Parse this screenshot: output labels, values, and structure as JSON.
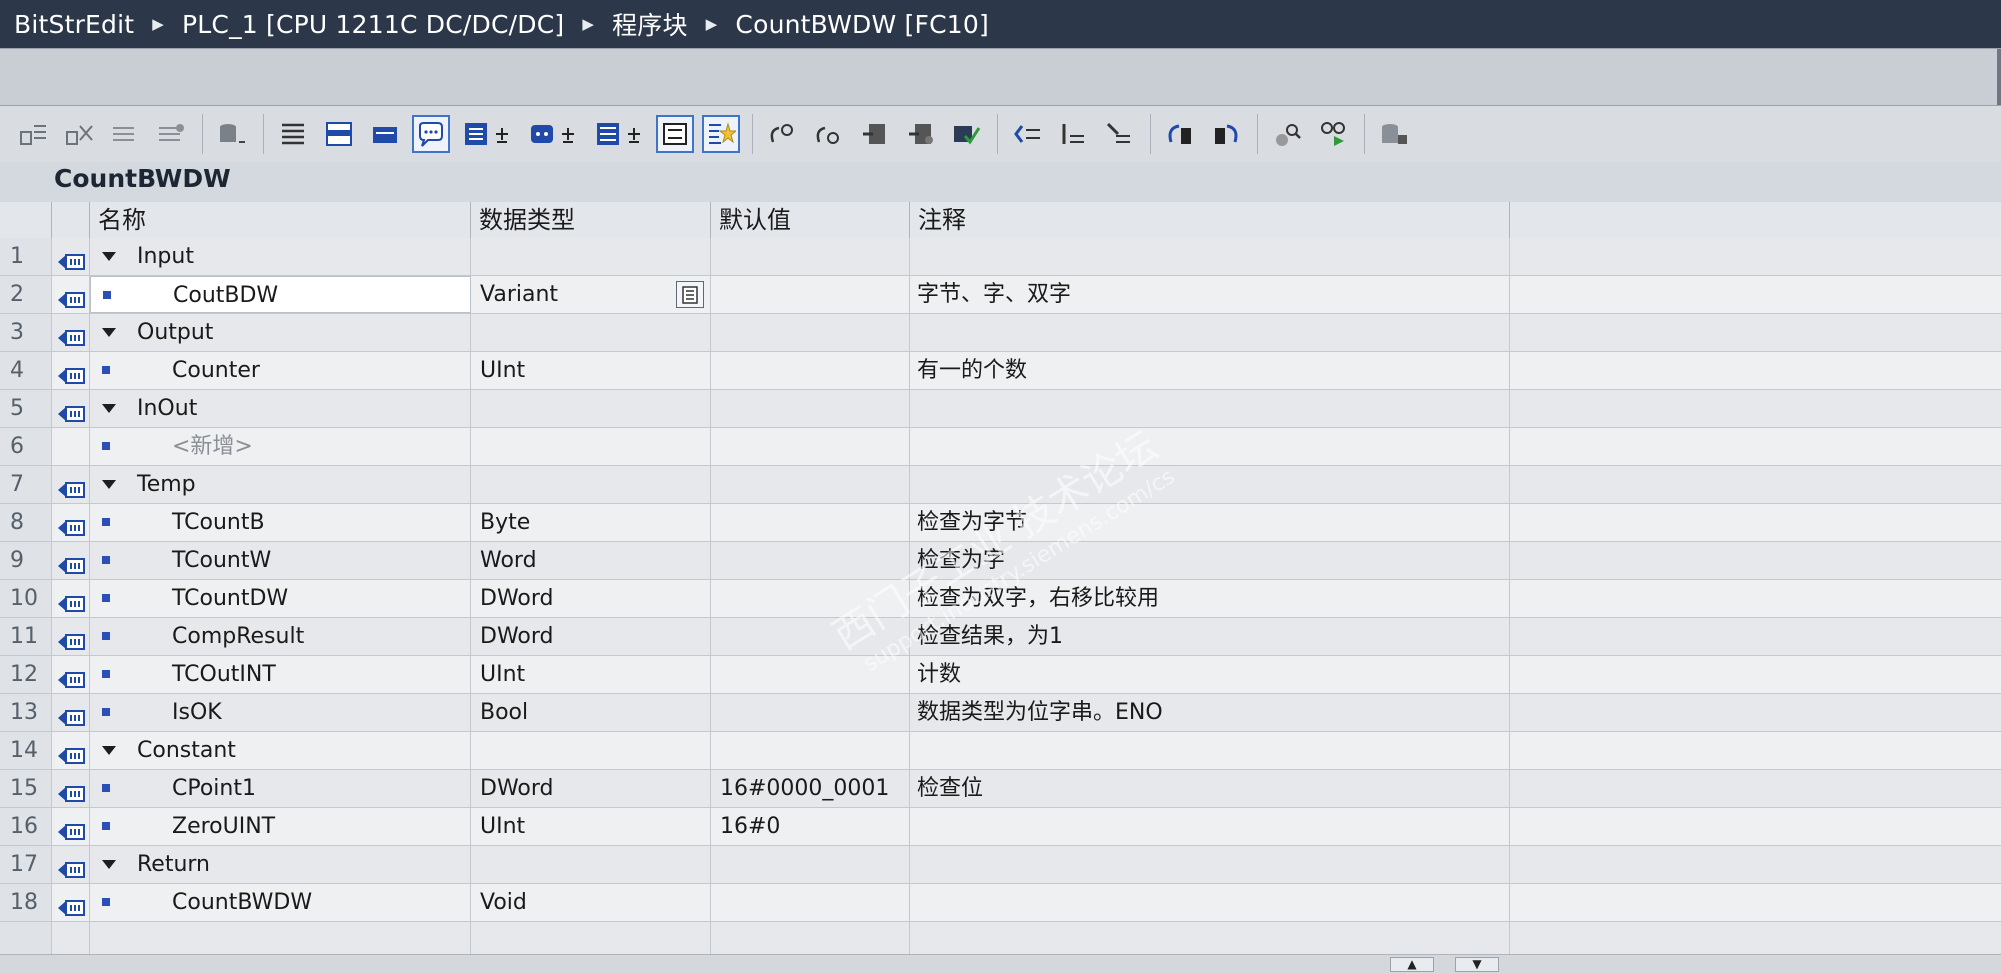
{
  "breadcrumb": {
    "items": [
      "BitStrEdit",
      "PLC_1 [CPU 1211C DC/DC/DC]",
      "程序块",
      "CountBWDW [FC10]"
    ],
    "separator": "▸"
  },
  "toolbar": {
    "icons": [
      "insert-row-icon",
      "add-row-icon",
      "insert-multi-icon",
      "delete-row-icon",
      "database-icon",
      "indent-icon",
      "expand-all-icon",
      "collapse-all-icon",
      "comment-icon",
      "show-interface-icon",
      "settings-dropdown-icon",
      "multi-instance-icon",
      "list-view-icon",
      "favorites-icon",
      "network-go-icon",
      "network-remove-icon",
      "open-block-icon",
      "close-block-icon",
      "compile-icon",
      "insert-network-icon",
      "add-branch-icon",
      "open-branch-icon",
      "go-previous-icon",
      "go-next-icon",
      "monitor-icon",
      "simulate-icon",
      "db-lock-icon"
    ]
  },
  "block_title": "CountBWDW",
  "table": {
    "headers": [
      "名称",
      "数据类型",
      "默认值",
      "注释"
    ],
    "rows": [
      {
        "num": "1",
        "section": true,
        "name": "Input",
        "type": "",
        "default": "",
        "comment": ""
      },
      {
        "num": "2",
        "section": false,
        "name": "CoutBDW",
        "type": "Variant",
        "default": "",
        "comment": "字节、字、双字",
        "editing": true
      },
      {
        "num": "3",
        "section": true,
        "name": "Output",
        "type": "",
        "default": "",
        "comment": ""
      },
      {
        "num": "4",
        "section": false,
        "name": "Counter",
        "type": "UInt",
        "default": "",
        "comment": "有一的个数"
      },
      {
        "num": "5",
        "section": true,
        "name": "InOut",
        "type": "",
        "default": "",
        "comment": ""
      },
      {
        "num": "6",
        "section": false,
        "name": "<新增>",
        "type": "",
        "default": "",
        "comment": "",
        "placeholder": true
      },
      {
        "num": "7",
        "section": true,
        "name": "Temp",
        "type": "",
        "default": "",
        "comment": ""
      },
      {
        "num": "8",
        "section": false,
        "name": "TCountB",
        "type": "Byte",
        "default": "",
        "comment": "检查为字节"
      },
      {
        "num": "9",
        "section": false,
        "name": "TCountW",
        "type": "Word",
        "default": "",
        "comment": "检查为字"
      },
      {
        "num": "10",
        "section": false,
        "name": "TCountDW",
        "type": "DWord",
        "default": "",
        "comment": "检查为双字，右移比较用"
      },
      {
        "num": "11",
        "section": false,
        "name": "CompResult",
        "type": "DWord",
        "default": "",
        "comment": "检查结果，为1"
      },
      {
        "num": "12",
        "section": false,
        "name": "TCOutINT",
        "type": "UInt",
        "default": "",
        "comment": "计数"
      },
      {
        "num": "13",
        "section": false,
        "name": "IsOK",
        "type": "Bool",
        "default": "",
        "comment": "数据类型为位字串。ENO"
      },
      {
        "num": "14",
        "section": true,
        "name": "Constant",
        "type": "",
        "default": "",
        "comment": ""
      },
      {
        "num": "15",
        "section": false,
        "name": "CPoint1",
        "type": "DWord",
        "default": "16#0000_0001",
        "comment": "检查位"
      },
      {
        "num": "16",
        "section": false,
        "name": "ZeroUINT",
        "type": "UInt",
        "default": "16#0",
        "comment": ""
      },
      {
        "num": "17",
        "section": true,
        "name": "Return",
        "type": "",
        "default": "",
        "comment": ""
      },
      {
        "num": "18",
        "section": false,
        "name": "CountBWDW",
        "type": "Void",
        "default": "",
        "comment": ""
      }
    ]
  },
  "watermark": {
    "main": "西门子工业  技术论坛",
    "sub": "support.industry.siemens.com/cs"
  },
  "colors": {
    "titlebar": "#2c3849",
    "accent": "#3f74c9",
    "row_marker": "#2b4fb6"
  }
}
